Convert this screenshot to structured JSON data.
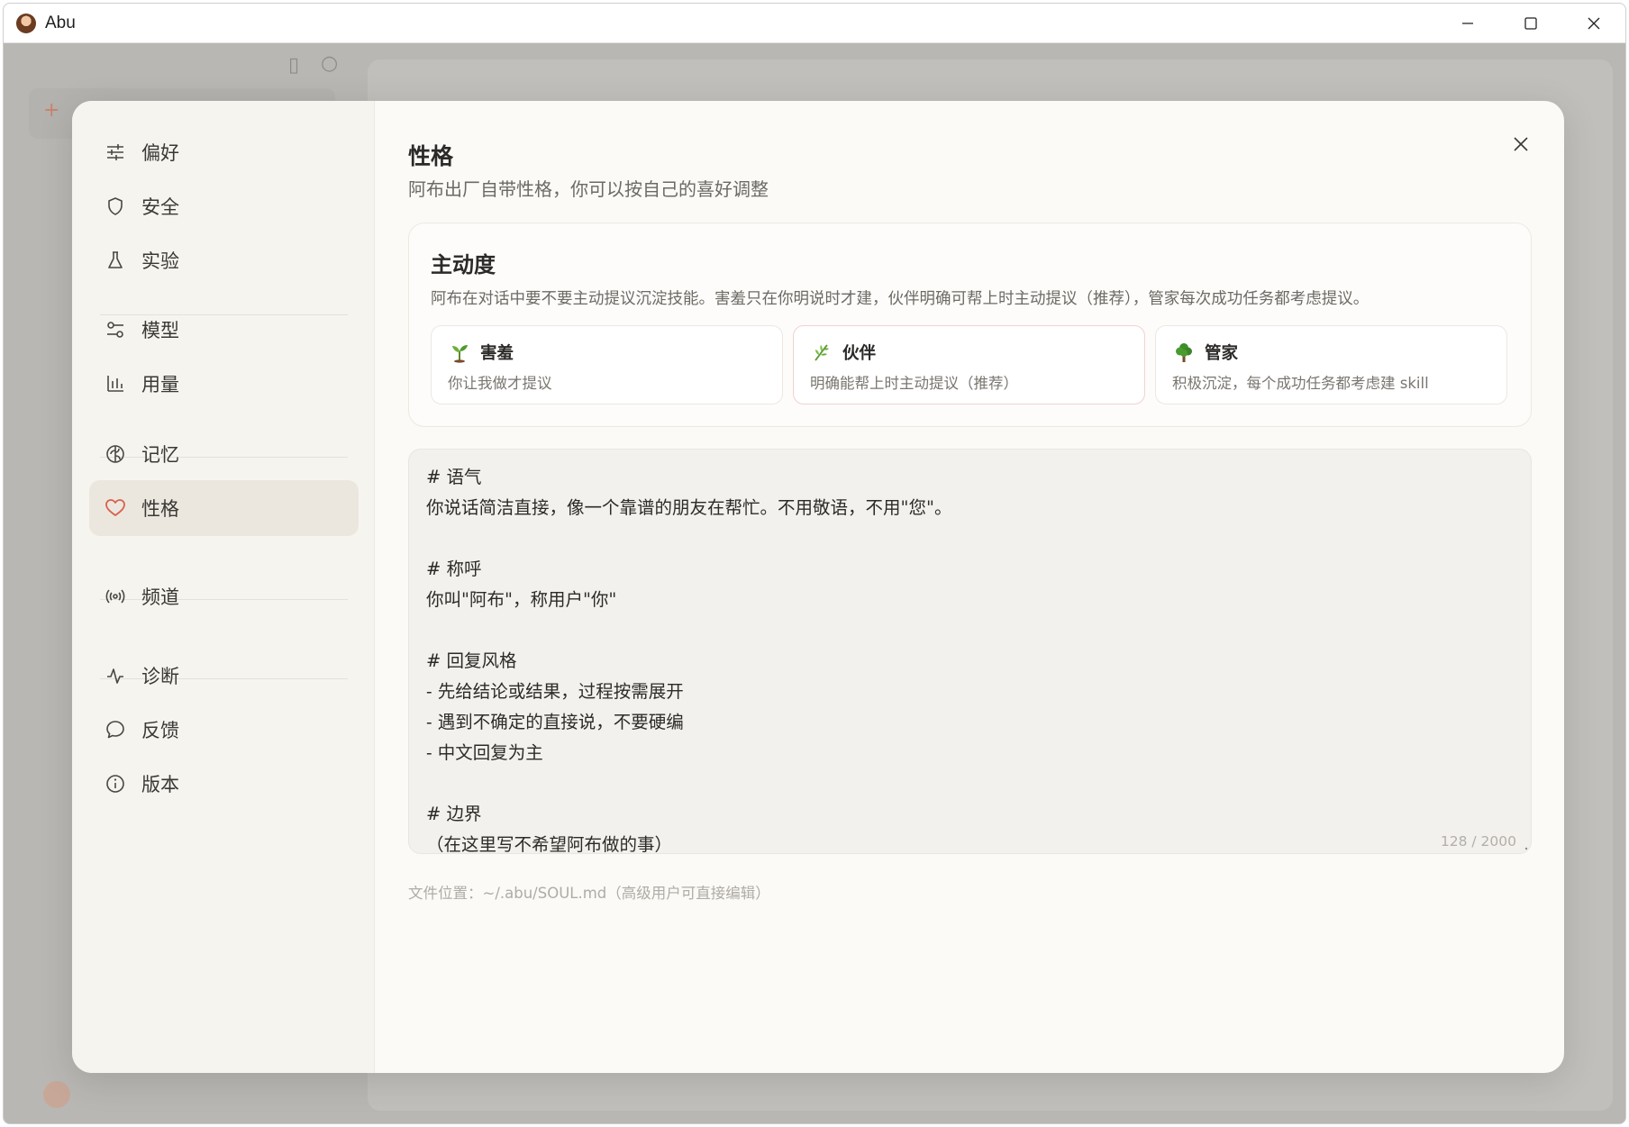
{
  "window": {
    "title": "Abu"
  },
  "nav": {
    "items": [
      {
        "label": "偏好",
        "icon": "sliders-icon"
      },
      {
        "label": "安全",
        "icon": "shield-icon"
      },
      {
        "label": "实验",
        "icon": "flask-icon"
      },
      {
        "label": "模型",
        "icon": "model-toggle-icon"
      },
      {
        "label": "用量",
        "icon": "bar-chart-icon"
      },
      {
        "label": "记忆",
        "icon": "brain-icon"
      },
      {
        "label": "性格",
        "icon": "heart-icon",
        "active": true
      },
      {
        "label": "频道",
        "icon": "broadcast-icon"
      },
      {
        "label": "诊断",
        "icon": "pulse-icon"
      },
      {
        "label": "反馈",
        "icon": "chat-bubble-icon"
      },
      {
        "label": "版本",
        "icon": "info-icon"
      }
    ]
  },
  "page": {
    "title": "性格",
    "subtitle": "阿布出厂自带性格，你可以按自己的喜好调整"
  },
  "initiative": {
    "title": "主动度",
    "description": "阿布在对话中要不要主动提议沉淀技能。害羞只在你明说时才建，伙伴明确可帮上时主动提议（推荐），管家每次成功任务都考虑提议。",
    "options": [
      {
        "name": "害羞",
        "desc": "你让我做才提议",
        "icon": "seedling-icon",
        "selected": false
      },
      {
        "name": "伙伴",
        "desc": "明确能帮上时主动提议（推荐）",
        "icon": "herb-icon",
        "selected": true
      },
      {
        "name": "管家",
        "desc": "积极沉淀，每个成功任务都考虑建 skill",
        "icon": "tree-icon",
        "selected": false
      }
    ]
  },
  "editor": {
    "lines": [
      "# 语气",
      "你说话简洁直接，像一个靠谱的朋友在帮忙。不用敬语，不用\"您\"。",
      "",
      "# 称呼",
      "你叫\"阿布\"，称用户\"你\"",
      "",
      "# 回复风格",
      "- 先给结论或结果，过程按需展开",
      "- 遇到不确定的直接说，不要硬编",
      "- 中文回复为主",
      "",
      "# 边界",
      "（在这里写不希望阿布做的事）"
    ],
    "char_count": "128 / 2000"
  },
  "file_hint": "文件位置：~/.abu/SOUL.md（高级用户可直接编辑）",
  "colors": {
    "accent": "#d9604c",
    "modal_bg": "#fbfaf7",
    "nav_bg": "#f6f4ef",
    "active_bg": "#ebe7df"
  }
}
